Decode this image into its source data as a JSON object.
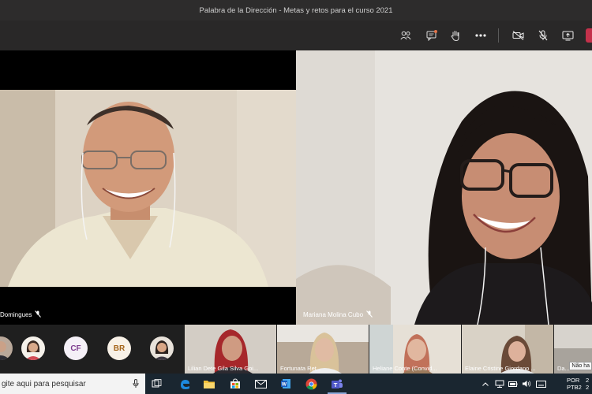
{
  "window": {
    "title": "Palabra de la Dirección - Metas y retos para el curso 2021"
  },
  "toolbar": {
    "icons": [
      "participants-icon",
      "chat-icon",
      "raise-hand-icon",
      "more-actions-icon",
      "camera-off-icon",
      "mic-off-icon",
      "share-screen-icon",
      "leave-call-icon"
    ]
  },
  "stage": {
    "left_participant": {
      "name": "Domingues"
    },
    "right_participant": {
      "name": "Mariana Molina Cubo"
    }
  },
  "strip": {
    "avatars": [
      {
        "initials": "CF",
        "color": "#7e3c8f",
        "bg": "#f5f0f7"
      },
      {
        "initials": "BR",
        "color": "#a5651a",
        "bg": "#f8f1e7"
      }
    ],
    "thumbnails": [
      {
        "name": "Lilian Dete Gila Silva Goi..."
      },
      {
        "name": "Fortunata Ret..."
      },
      {
        "name": "Heliane Conte (Convid..."
      },
      {
        "name": "Elaine Cristine Giordano ..."
      },
      {
        "name": "Da..."
      }
    ],
    "tooltip": "Não ha"
  },
  "taskbar": {
    "search_placeholder": "gite aqui para pesquisar",
    "lang_top": "POR",
    "lang_bottom": "PTB2",
    "clock_top": "2",
    "clock_bottom": "2"
  },
  "colors": {
    "accent": "#6264a7",
    "leave": "#c4314b",
    "notif": "#e2744a"
  }
}
